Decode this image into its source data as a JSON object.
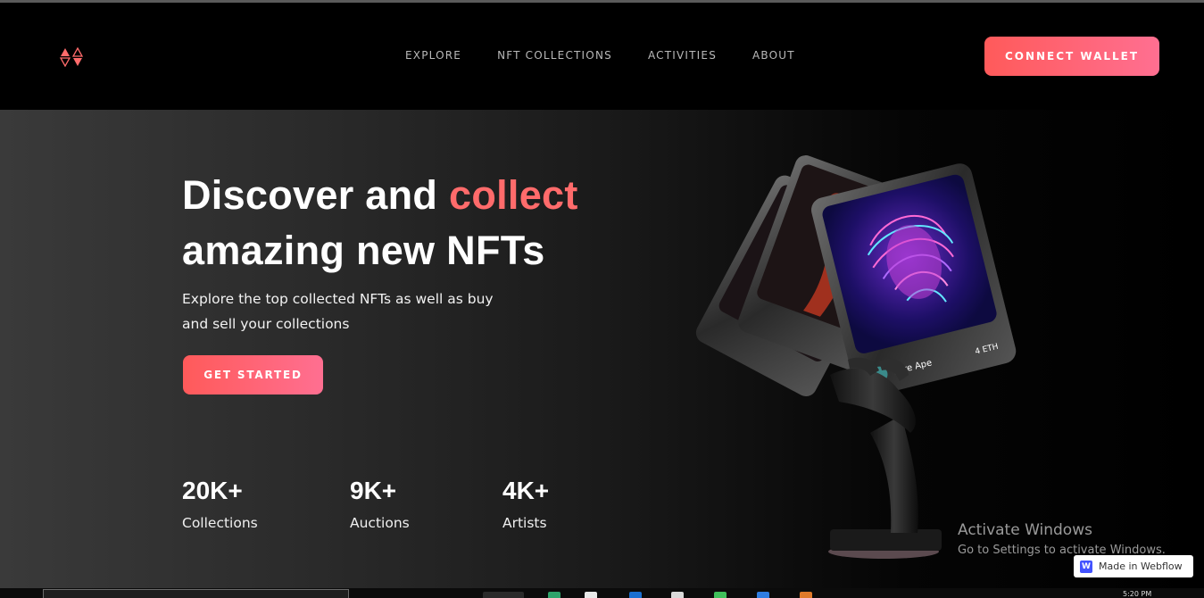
{
  "header": {
    "logo_icon": "triangle-diamond-logo-icon",
    "nav": [
      "EXPLORE",
      "NFT COLLECTIONS",
      "ACTIVITIES",
      "ABOUT"
    ],
    "connect_label": "CONNECT WALLET"
  },
  "hero": {
    "title_part1": "Discover and ",
    "title_accent": "collect",
    "title_part2": "amazing new NFTs",
    "subtitle": "Explore the top collected NFTs as well as buy and sell your collections",
    "cta_label": "GET STARTED",
    "stats": [
      {
        "value": "20K+",
        "label": "Collections"
      },
      {
        "value": "9K+",
        "label": "Auctions"
      },
      {
        "value": "4K+",
        "label": "Artists"
      }
    ]
  },
  "art": {
    "card_name": "Wire Ape",
    "card_price": "4 ETH",
    "illustration": "hand-holding-nft-cards-illustration"
  },
  "watermark": {
    "title": "Activate Windows",
    "subtitle": "Go to Settings to activate Windows."
  },
  "badge": {
    "label": "Made in Webflow",
    "icon": "W"
  },
  "taskbar": {
    "clock": "5:20 PM"
  },
  "colors": {
    "accent": "#ff6b6b",
    "button_start": "#ff5a5a",
    "button_end": "#ff6f91",
    "background": "#000000"
  }
}
